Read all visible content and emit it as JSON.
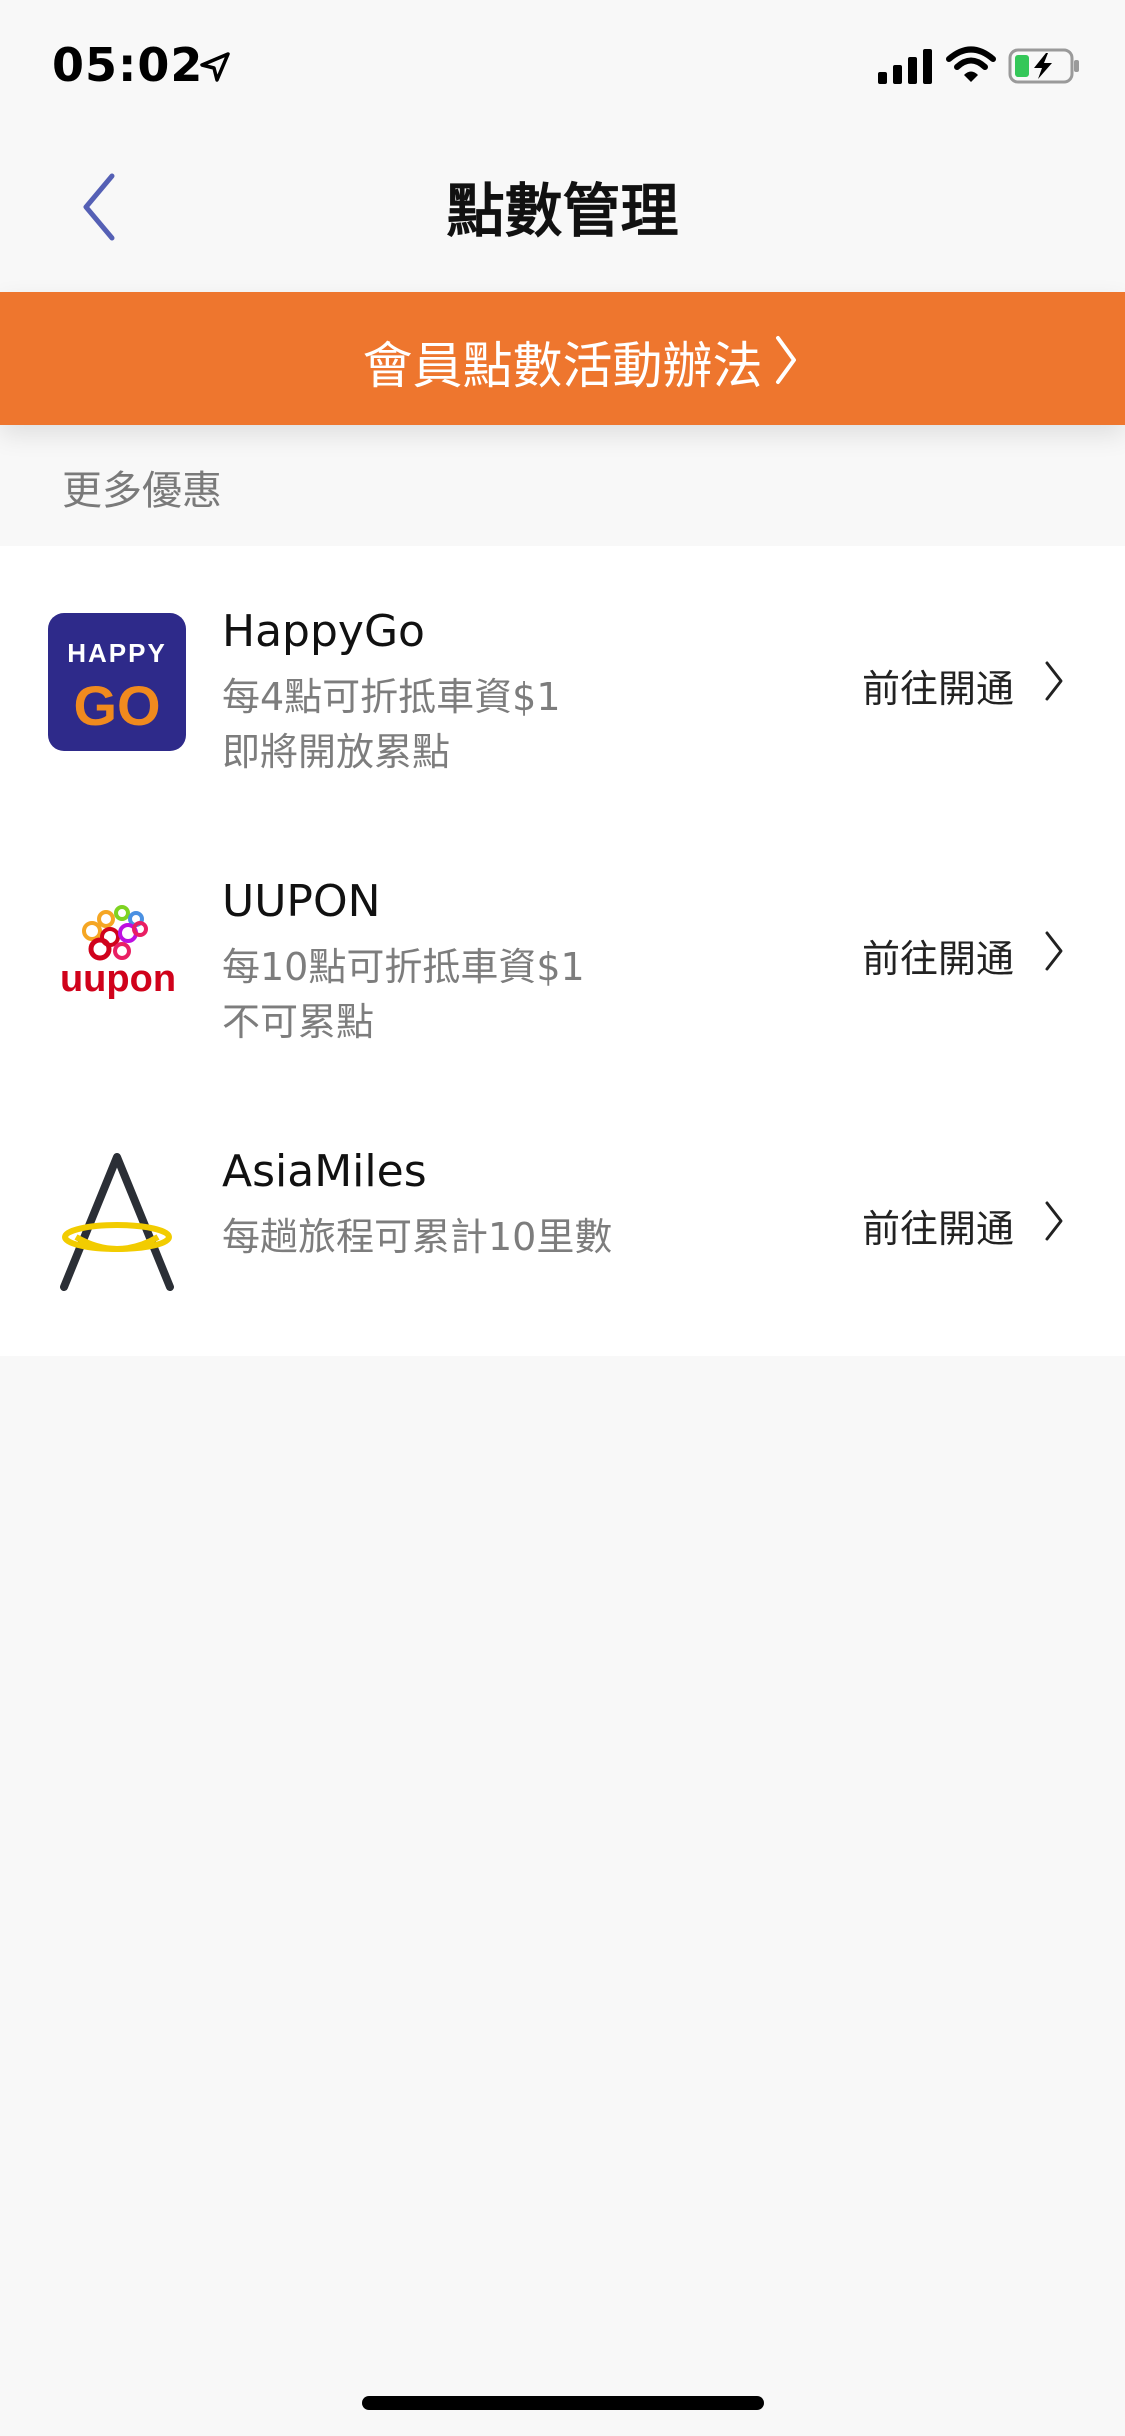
{
  "status_bar": {
    "time": "05:02"
  },
  "nav": {
    "title": "點數管理"
  },
  "banner": {
    "label": "會員點數活動辦法"
  },
  "section": {
    "title": "更多優惠"
  },
  "programs": [
    {
      "name": "HappyGo",
      "line1": "每4點可折抵車資$1",
      "line2": "即將開放累點",
      "action": "前往開通",
      "logo_text_top": "HAPPY",
      "logo_text_bottom": "GO"
    },
    {
      "name": "UUPON",
      "line1": "每10點可折抵車資$1",
      "line2": "不可累點",
      "action": "前往開通",
      "logo_text": "uupon"
    },
    {
      "name": "AsiaMiles",
      "line1": "每趟旅程可累計10里數",
      "action": "前往開通"
    }
  ],
  "colors": {
    "accent": "#ee762e",
    "back_arrow": "#5560b5",
    "happygo_bg": "#2e2a8a",
    "happygo_orange": "#f08a1e"
  }
}
